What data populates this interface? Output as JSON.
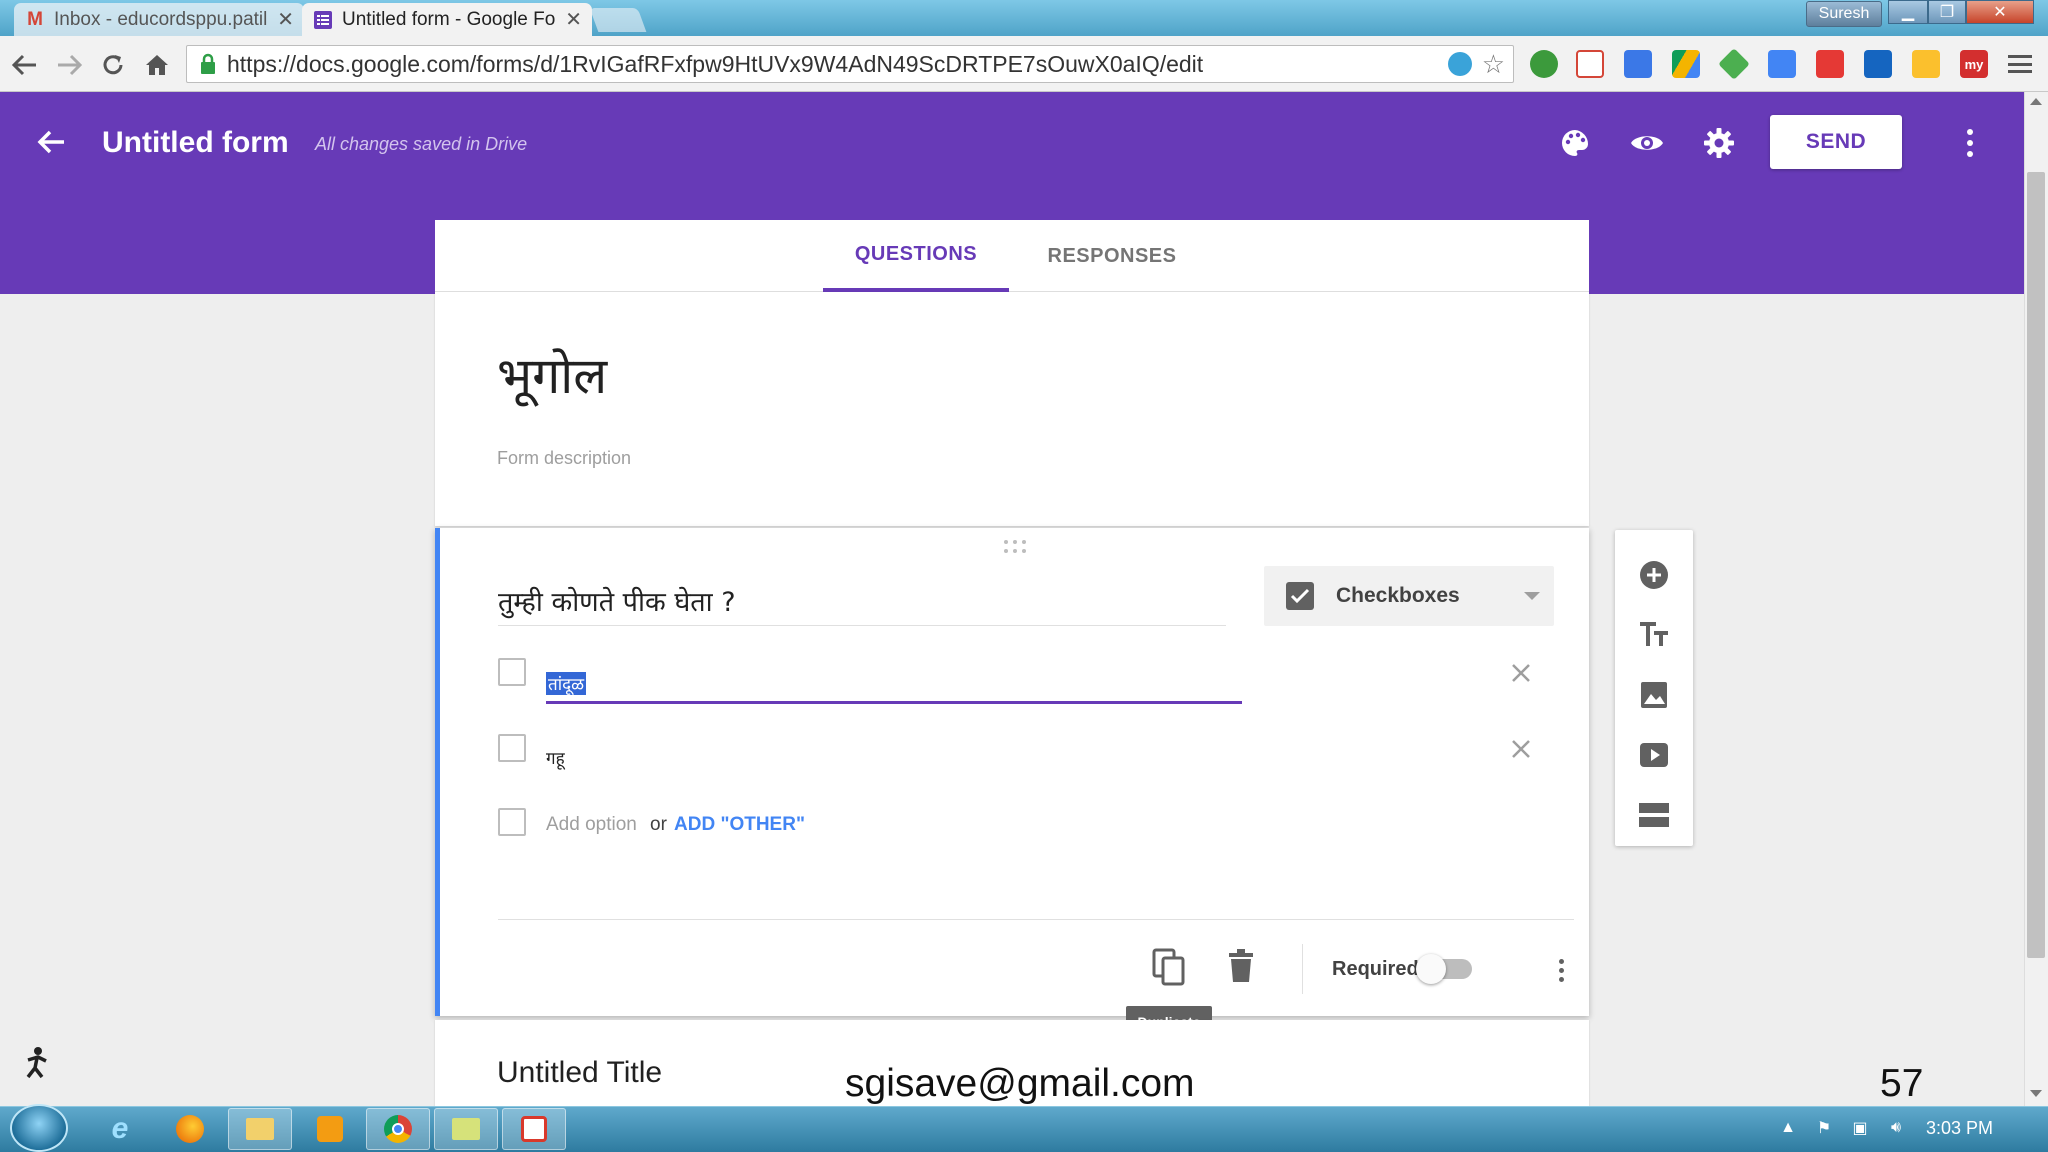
{
  "browser": {
    "tabs": [
      {
        "title": "Inbox - educordsppu.patil",
        "icon": "gmail-icon",
        "active": false
      },
      {
        "title": "Untitled form - Google Fo",
        "icon": "google-forms-icon",
        "active": true
      }
    ],
    "url": "https://docs.google.com/forms/d/1RvIGafRFxfpw9HtUVx9W4AdN49ScDRTPE7sOuwX0aIQ/edit",
    "user": "Suresh"
  },
  "header": {
    "title": "Untitled form",
    "save_status": "All changes saved in Drive",
    "send_label": "SEND",
    "icons": [
      "palette-icon",
      "eye-icon",
      "gear-icon",
      "more-vert-icon"
    ]
  },
  "tabs": {
    "questions": "QUESTIONS",
    "responses": "RESPONSES"
  },
  "form": {
    "title": "भूगोल",
    "description_placeholder": "Form description"
  },
  "question": {
    "title": "तुम्ही कोणते पीक घेता ?",
    "type": "Checkboxes",
    "options": [
      "तांदूळ",
      "गहू"
    ],
    "add_option": "Add option",
    "or": "or",
    "add_other": "ADD \"OTHER\"",
    "required_label": "Required",
    "required": false
  },
  "tooltip": "Duplicate",
  "next_section": {
    "title": "Untitled Title"
  },
  "side_toolbar": [
    "add-question-icon",
    "title-text-icon",
    "image-icon",
    "video-icon",
    "section-icon"
  ],
  "overlay": {
    "email": "sgisave@gmail.com",
    "page_number": "57"
  },
  "taskbar": {
    "clock": "3:03 PM"
  },
  "colors": {
    "accent": "#673ab7",
    "focus": "#4285f4"
  }
}
